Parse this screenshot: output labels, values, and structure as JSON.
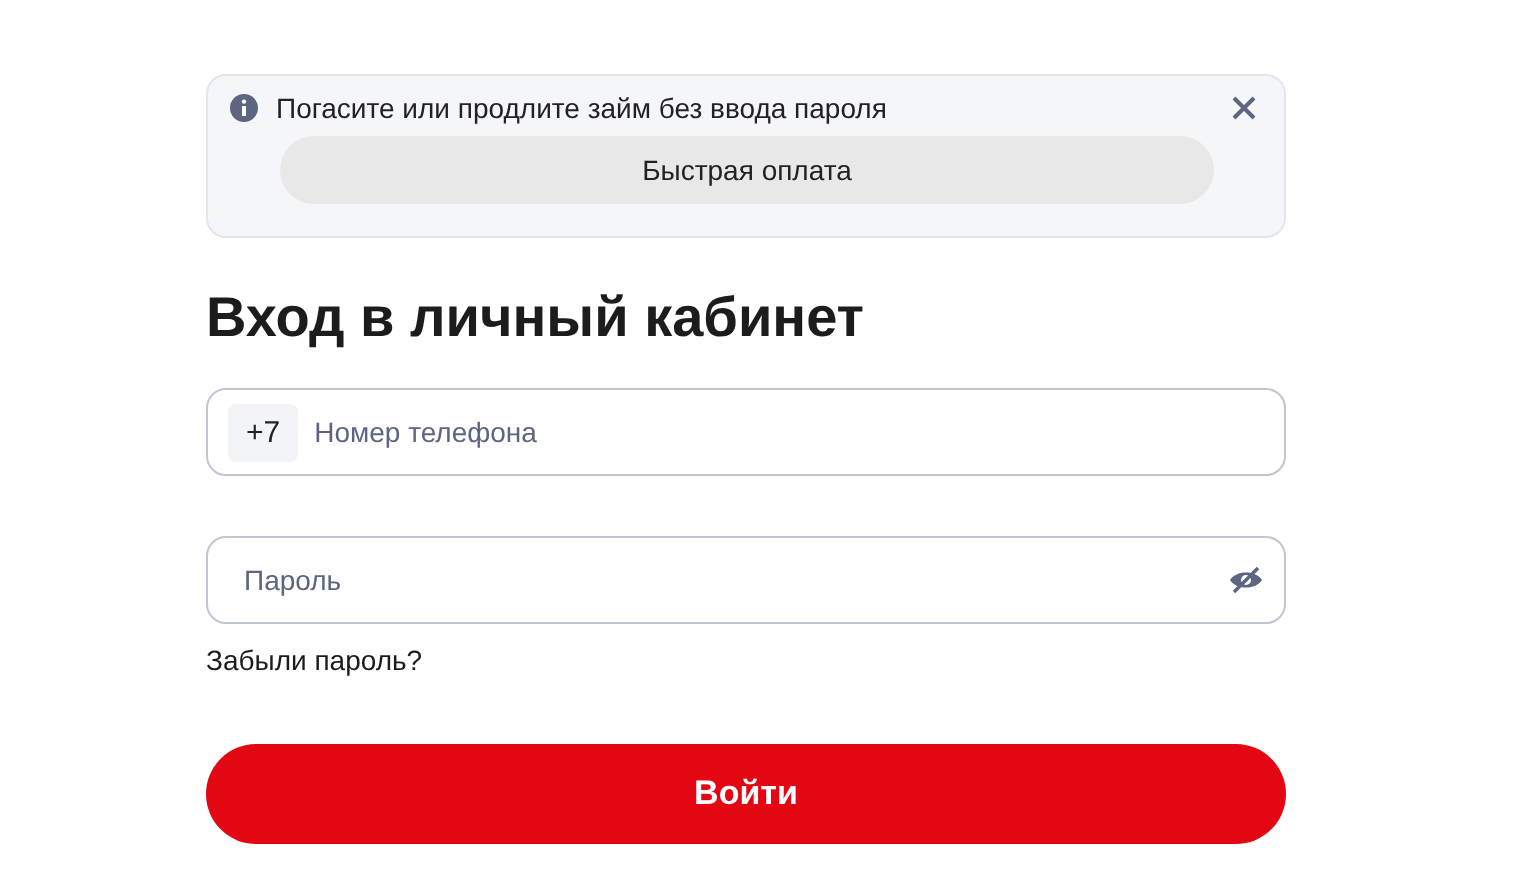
{
  "banner": {
    "message": "Погасите или продлите займ без ввода пароля",
    "action": "Быстрая оплата"
  },
  "title": "Вход в личный кабинет",
  "phone": {
    "prefix": "+7",
    "placeholder": "Номер телефона"
  },
  "password": {
    "placeholder": "Пароль"
  },
  "forgot": "Забыли пароль?",
  "submit": "Войти"
}
